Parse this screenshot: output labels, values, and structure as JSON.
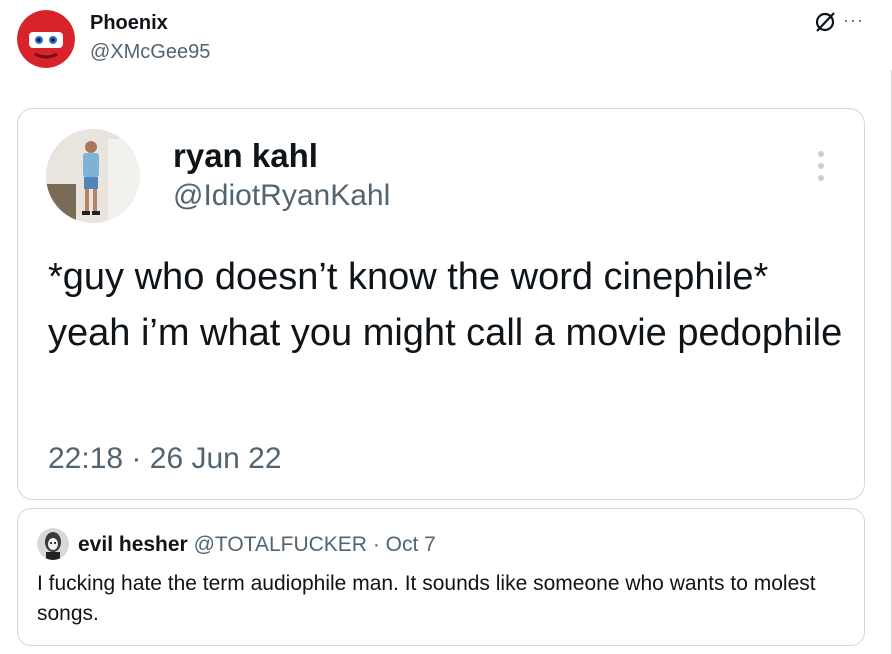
{
  "outer": {
    "name": "Phoenix",
    "handle": "@XMcGee95",
    "more": "···"
  },
  "quoted": {
    "name": "ryan kahl",
    "handle": "@IdiotRyanKahl",
    "text": "*guy who doesn’t know the word cinephile* yeah i’m what you might call a movie pedophile",
    "time": "22:18",
    "sep": "·",
    "date": "26 Jun 22"
  },
  "quote": {
    "name": "evil hesher",
    "handle": "@TOTALFUCKER",
    "sep": "·",
    "date": "Oct 7",
    "text": "I fucking hate the term audiophile man. It sounds like someone who wants to molest songs."
  },
  "icons": [
    "grok-icon",
    "more-icon",
    "kebab-icon"
  ],
  "colors": {
    "text": "#0f1419",
    "secondary": "#536471",
    "border": "#cfd9de"
  }
}
